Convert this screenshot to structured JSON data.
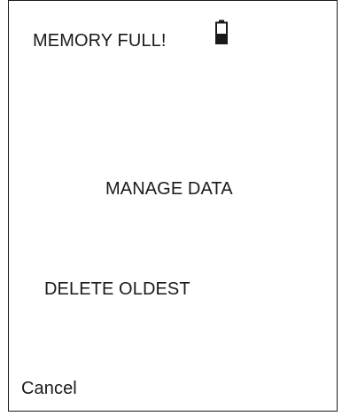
{
  "screen": {
    "title": "MEMORY FULL!",
    "battery_icon": "battery-low-icon",
    "menu": {
      "manage_data_label": "MANAGE DATA",
      "delete_oldest_label": "DELETE OLDEST"
    },
    "softkey": {
      "cancel_label": "Cancel"
    }
  },
  "colors": {
    "text": "#1a1a1a",
    "background": "#ffffff",
    "border": "#1a1a1a"
  }
}
